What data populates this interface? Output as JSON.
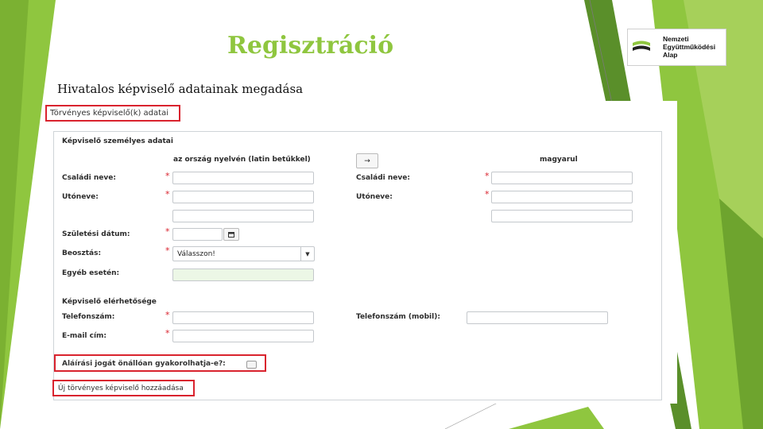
{
  "slide": {
    "title": "Regisztráció",
    "subtitle": "Hivatalos képviselő adatainak megadása",
    "accent": "#8fc63f",
    "highlight_color": "#d9232e"
  },
  "logo": {
    "icon": "logo-mark-icon",
    "line1": "Nemzeti",
    "line2": "Együttműködési",
    "line3": "Alap"
  },
  "form": {
    "section_title": "Törvényes képviselő(k) adatai",
    "personal_heading": "Képviselő személyes adatai",
    "col_left_heading": "az ország nyelvén (latin betűkkel)",
    "col_right_heading": "magyarul",
    "copy_button": "→",
    "required_mark": "*",
    "left": {
      "family_name_label": "Családi neve:",
      "given_name_label": "Utóneve:",
      "birth_date_label": "Születési dátum:",
      "position_label": "Beosztás:",
      "position_selected": "Válasszon!",
      "other_label": "Egyéb esetén:",
      "calendar_icon": "calendar-icon"
    },
    "right": {
      "family_name_label": "Családi neve:",
      "given_name_label": "Utóneve:"
    },
    "contact_heading": "Képviselő elérhetősége",
    "phone_label": "Telefonszám:",
    "email_label": "E-mail cím:",
    "mobile_label": "Telefonszám (mobil):",
    "signature_label": "Aláírási jogát önállóan gyakorolhatja-e?:",
    "add_link": "Új törvényes képviselő hozzáadása"
  }
}
